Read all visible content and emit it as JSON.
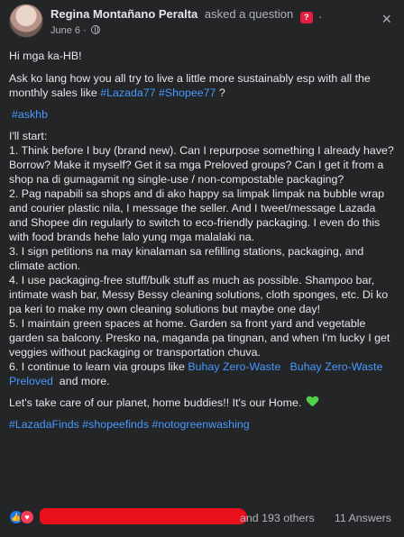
{
  "post": {
    "author": "Regina Montañano Peralta",
    "action": "asked a question",
    "date": "June 6",
    "separator": "·",
    "close_icon": "×",
    "greeting": "Hi mga ka-HB!",
    "question_pre": "Ask ko lang how you all try to live a little more sustainably esp with all the monthly sales like ",
    "hashtag_lazada77": "#Lazada77",
    "hashtag_shopee77": "#Shopee77",
    "question_post": " ?",
    "hashtag_askhb": "#askhb",
    "intro": "I'll start:",
    "items": [
      "1. Think before I buy (brand new). Can I repurpose something I already have? Borrow? Make it myself? Get it sa mga Preloved groups? Can I get it from a shop na di gumagamit ng single-use / non-compostable packaging?",
      "2. Pag napabili sa shops and di ako happy sa limpak limpak na bubble wrap and courier plastic nila, I message the seller. And I tweet/message Lazada and Shopee din regularly to switch to eco-friendly packaging. I even do this with food brands hehe lalo yung mga malalaki na.",
      "3. I sign petitions na may kinalaman sa refilling stations, packaging, and climate action.",
      "4. I use packaging-free stuff/bulk stuff as much as possible. Shampoo bar, intimate wash bar, Messy Bessy cleaning solutions, cloth sponges, etc. Di ko pa keri to make my own cleaning solutions but maybe one day!",
      "5. I maintain green spaces at home. Garden sa front yard and vegetable garden sa balcony. Presko na, maganda pa tingnan, and when I'm lucky I get veggies without packaging or transportation chuva."
    ],
    "item6_pre": "6. I continue to learn via groups like ",
    "group1": "Buhay Zero-Waste",
    "group2": "Buhay Zero-Waste Preloved",
    "item6_post": " and more.",
    "closing": "Let's take care of our planet, home buddies!! It's our Home. ",
    "hashtags_footer": "#LazadaFinds #shopeefinds #notogreenwashing"
  },
  "footer": {
    "others": "and 193 others",
    "answers": "11 Answers"
  },
  "icons": {
    "like": "thumbs-up-icon",
    "love": "heart-icon",
    "globe": "globe-icon",
    "green_heart": "green-heart-icon",
    "question_badge": "question-badge-icon"
  }
}
